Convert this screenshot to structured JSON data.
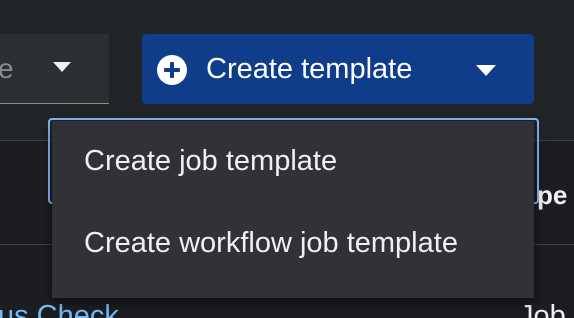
{
  "toolbar": {
    "filter_select_text": "e",
    "create_button_label": "Create template"
  },
  "menu": {
    "items": [
      {
        "label": "Create job template"
      },
      {
        "label": "Create workflow job template"
      }
    ]
  },
  "table": {
    "column_header_partial": "pe",
    "row": {
      "name_partial": "us Check",
      "type_partial": "Job"
    }
  },
  "colors": {
    "primary_button": "#0f3d8a",
    "menu_background": "#303236",
    "link": "#73bcf7",
    "focus_outline": "#8ab8f5"
  }
}
